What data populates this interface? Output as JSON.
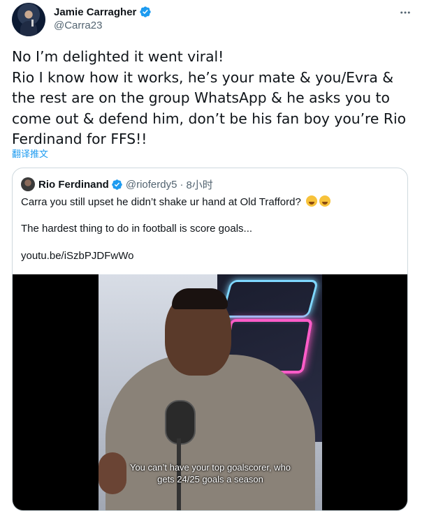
{
  "author": {
    "display_name": "Jamie Carragher",
    "handle": "@Carra23",
    "avatar_icon": "profile-photo"
  },
  "tweet": {
    "text": "No I’m delighted it went viral!\nRio I know how it works, he’s your mate & you/Evra &\nthe rest are on the group WhatsApp & he asks you to\ncome out & defend him, don’t be his fan boy you’re Rio\nFerdinand for FFS!!",
    "translate_label": "翻译推文"
  },
  "quoted": {
    "display_name": "Rio Ferdinand",
    "handle": "@rioferdy5",
    "dot": "·",
    "time": "8小时",
    "line1": "Carra you still upset he didn’t shake ur hand at Old Trafford?",
    "line2": "The hardest thing to do in football is score goals...",
    "link": "youtu.be/iSzbPJDFwWo",
    "video_caption_line1": "You can’t have your top goalscorer, who",
    "video_caption_line2": "gets 24/25 goals a season"
  },
  "colors": {
    "accent": "#1d9bf0",
    "secondary_text": "#536471",
    "border": "#cfd9de"
  }
}
